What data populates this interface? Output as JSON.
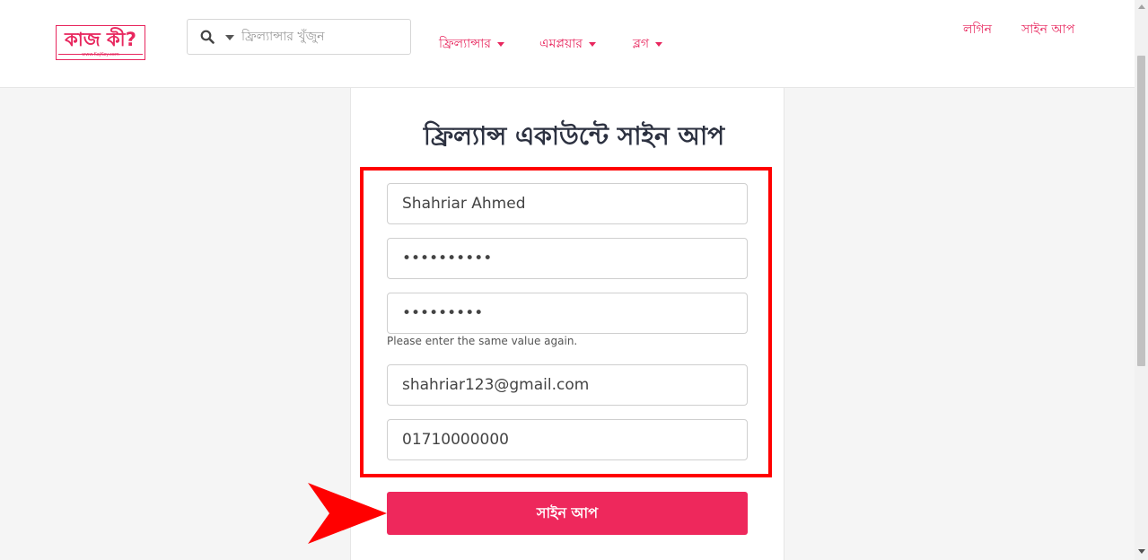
{
  "header": {
    "logo": {
      "text": "কাজ কী?",
      "subtext": "www.KajKey.com"
    },
    "search": {
      "placeholder": "ফ্রিল্যান্সার খুঁজুন",
      "icon": "search-icon",
      "filter_icon": "caret-down-icon"
    },
    "nav": [
      {
        "label": "ফ্রিল্যান্সার"
      },
      {
        "label": "এমপ্লয়ার"
      },
      {
        "label": "ব্লগ"
      }
    ],
    "login_label": "লগিন",
    "signup_label": "সাইন আপ"
  },
  "form": {
    "title": "ফ্রিল্যান্স একাউন্টে সাইন আপ",
    "fields": {
      "name": "Shahriar Ahmed",
      "password": "••••••••••",
      "confirm_password": "•••••••••",
      "confirm_error": "Please enter the same value again.",
      "email": "shahriar123@gmail.com",
      "phone": "01710000000"
    },
    "submit_label": "সাইন আপ"
  },
  "colors": {
    "accent": "#ee285c",
    "highlight": "#ff0000",
    "title": "#2c3140"
  }
}
